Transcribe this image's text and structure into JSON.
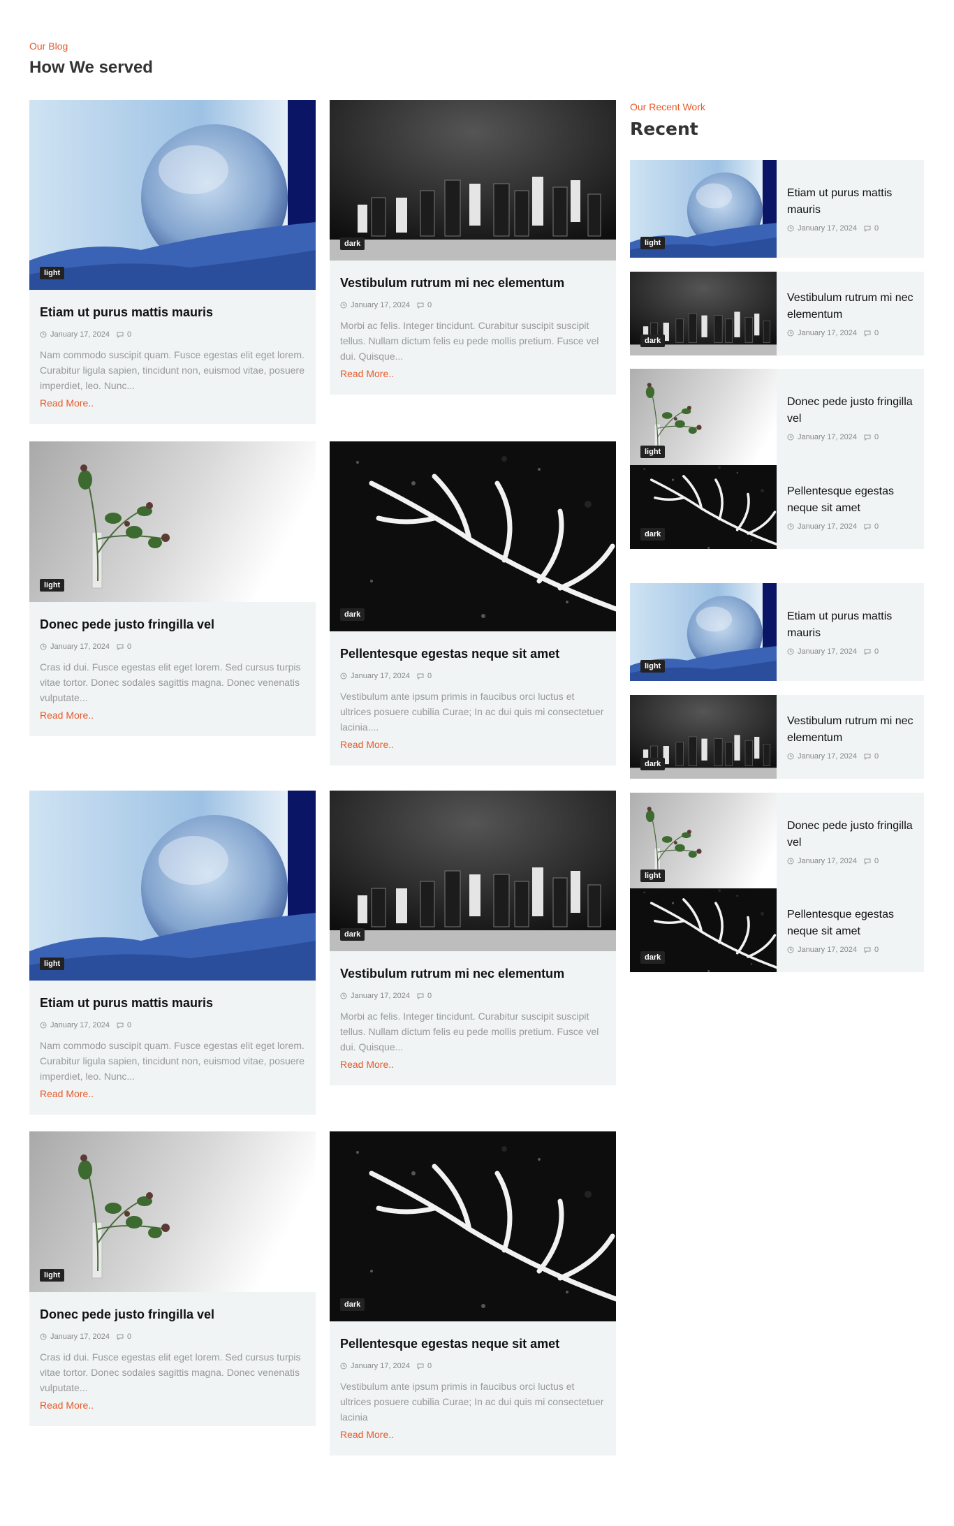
{
  "blog": {
    "eyebrow": "Our Blog",
    "title": "How We served",
    "read_more": "Read More.."
  },
  "recent": {
    "eyebrow": "Our Recent Work",
    "title": "Recent"
  },
  "posts": [
    {
      "title": "Etiam ut purus mattis mauris",
      "date": "January 17, 2024",
      "comments": "0",
      "badge": "light",
      "image": "bubble",
      "excerpt": "Nam commodo suscipit quam. Fusce egestas elit eget lorem. Curabitur ligula sapien, tincidunt non, euismod vitae, posuere imperdiet, leo. Nunc..."
    },
    {
      "title": "Vestibulum rutrum mi nec elementum",
      "date": "January 17, 2024",
      "comments": "0",
      "badge": "dark",
      "image": "chess",
      "excerpt": "Morbi ac felis. Integer tincidunt. Curabitur suscipit suscipit tellus. Nullam dictum felis eu pede mollis pretium. Fusce vel dui. Quisque..."
    },
    {
      "title": "Donec pede justo fringilla vel",
      "date": "January 17, 2024",
      "comments": "0",
      "badge": "light",
      "image": "flower",
      "excerpt": "Cras id dui. Fusce egestas elit eget lorem. Sed cursus turpis vitae tortor. Donec sodales sagittis magna. Donec venenatis vulputate..."
    },
    {
      "title": "Pellentesque egestas neque sit amet",
      "date": "January 17, 2024",
      "comments": "0",
      "badge": "dark",
      "image": "frost",
      "excerpt": "Vestibulum ante ipsum primis in faucibus orci luctus et ultrices posuere cubilia Curae; In ac dui quis mi consectetuer lacinia...."
    },
    {
      "title": "Etiam ut purus mattis mauris",
      "date": "January 17, 2024",
      "comments": "0",
      "badge": "light",
      "image": "bubble",
      "excerpt": "Nam commodo suscipit quam. Fusce egestas elit eget lorem. Curabitur ligula sapien, tincidunt non, euismod vitae, posuere imperdiet, leo. Nunc..."
    },
    {
      "title": "Vestibulum rutrum mi nec elementum",
      "date": "January 17, 2024",
      "comments": "0",
      "badge": "dark",
      "image": "chess",
      "excerpt": "Morbi ac felis. Integer tincidunt. Curabitur suscipit suscipit tellus. Nullam dictum felis eu pede mollis pretium. Fusce vel dui. Quisque..."
    },
    {
      "title": "Donec pede justo fringilla vel",
      "date": "January 17, 2024",
      "comments": "0",
      "badge": "light",
      "image": "flower",
      "excerpt": "Cras id dui. Fusce egestas elit eget lorem. Sed cursus turpis vitae tortor. Donec sodales sagittis magna. Donec venenatis vulputate..."
    },
    {
      "title": "Pellentesque egestas neque sit amet",
      "date": "January 17, 2024",
      "comments": "0",
      "badge": "dark",
      "image": "frost",
      "excerpt": "Vestibulum ante ipsum primis in faucibus orci luctus et ultrices posuere cubilia Curae; In ac dui quis mi consectetuer lacinia"
    }
  ],
  "recent_items": [
    {
      "title": "Etiam ut purus mattis mauris",
      "date": "January 17, 2024",
      "comments": "0",
      "badge": "light",
      "image": "bubble"
    },
    {
      "title": "Vestibulum rutrum mi nec elementum",
      "date": "January 17, 2024",
      "comments": "0",
      "badge": "dark",
      "image": "chess"
    },
    {
      "title": "Donec pede justo fringilla vel",
      "date": "January 17, 2024",
      "comments": "0",
      "badge": "light",
      "image": "flower"
    },
    {
      "title": "Pellentesque egestas neque sit amet",
      "date": "January 17, 2024",
      "comments": "0",
      "badge": "dark",
      "image": "frost"
    },
    {
      "title": "Etiam ut purus mattis mauris",
      "date": "January 17, 2024",
      "comments": "0",
      "badge": "light",
      "image": "bubble"
    },
    {
      "title": "Vestibulum rutrum mi nec elementum",
      "date": "January 17, 2024",
      "comments": "0",
      "badge": "dark",
      "image": "chess"
    },
    {
      "title": "Donec pede justo fringilla vel",
      "date": "January 17, 2024",
      "comments": "0",
      "badge": "light",
      "image": "flower"
    },
    {
      "title": "Pellentesque egestas neque sit amet",
      "date": "January 17, 2024",
      "comments": "0",
      "badge": "dark",
      "image": "frost"
    }
  ],
  "colors": {
    "accent": "#e8582a",
    "card_bg": "#f0f4f4",
    "badge_bg": "#222222"
  }
}
